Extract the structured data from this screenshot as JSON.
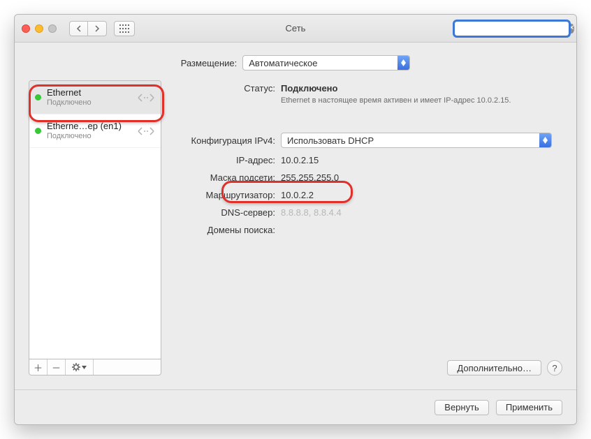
{
  "window": {
    "title": "Сеть"
  },
  "search": {
    "placeholder": ""
  },
  "location": {
    "label": "Размещение:",
    "value": "Автоматическое"
  },
  "sidebar": {
    "items": [
      {
        "name": "Ethernet",
        "sub": "Подключено",
        "status": "green"
      },
      {
        "name": "Etherne…ep (en1)",
        "sub": "Подключено",
        "status": "green"
      }
    ]
  },
  "detail": {
    "status_label": "Статус:",
    "status_value": "Подключено",
    "status_desc": "Ethernet в настоящее время активен и имеет IP-адрес 10.0.2.15.",
    "config_label": "Конфигурация IPv4:",
    "config_value": "Использовать DHCP",
    "ip_label": "IP-адрес:",
    "ip_value": "10.0.2.15",
    "mask_label": "Маска подсети:",
    "mask_value": "255.255.255.0",
    "router_label": "Маршрутизатор:",
    "router_value": "10.0.2.2",
    "dns_label": "DNS-сервер:",
    "dns_value": "8.8.8.8, 8.8.4.4",
    "sd_label": "Домены поиска:",
    "sd_value": ""
  },
  "buttons": {
    "advanced": "Дополнительно…",
    "revert": "Вернуть",
    "apply": "Применить"
  }
}
